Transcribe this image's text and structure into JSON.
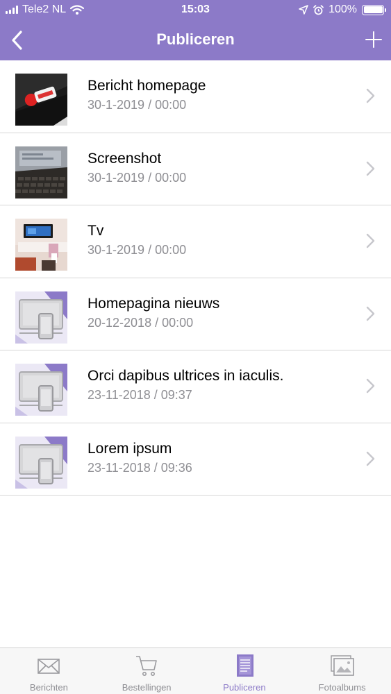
{
  "status_bar": {
    "carrier": "Tele2 NL",
    "time": "15:03",
    "battery": "100%",
    "battery_level": 1.0
  },
  "nav": {
    "title": "Publiceren",
    "back_icon": "chevron-left-icon",
    "add_icon": "plus-icon"
  },
  "items": [
    {
      "title": "Bericht homepage",
      "date": "30-1-2019 / 00:00",
      "thumb": "laptop-logo-photo"
    },
    {
      "title": "Screenshot",
      "date": "30-1-2019 / 00:00",
      "thumb": "keyboard-screen-photo"
    },
    {
      "title": "Tv",
      "date": "30-1-2019 / 00:00",
      "thumb": "tv-wall-photo"
    },
    {
      "title": "Homepagina nieuws",
      "date": "20-12-2018 / 00:00",
      "thumb": "devices-placeholder"
    },
    {
      "title": "Orci dapibus ultrices in iaculis.",
      "date": "23-11-2018 / 09:37",
      "thumb": "devices-placeholder"
    },
    {
      "title": "Lorem ipsum",
      "date": "23-11-2018 / 09:36",
      "thumb": "devices-placeholder"
    }
  ],
  "tabs": [
    {
      "label": "Berichten",
      "icon": "envelope-icon",
      "active": false
    },
    {
      "label": "Bestellingen",
      "icon": "cart-icon",
      "active": false
    },
    {
      "label": "Publiceren",
      "icon": "document-icon",
      "active": true
    },
    {
      "label": "Fotoalbums",
      "icon": "photo-album-icon",
      "active": false
    }
  ],
  "colors": {
    "accent": "#8c7ac8",
    "secondary_text": "#8e8e93",
    "separator": "#d6d6d6"
  }
}
